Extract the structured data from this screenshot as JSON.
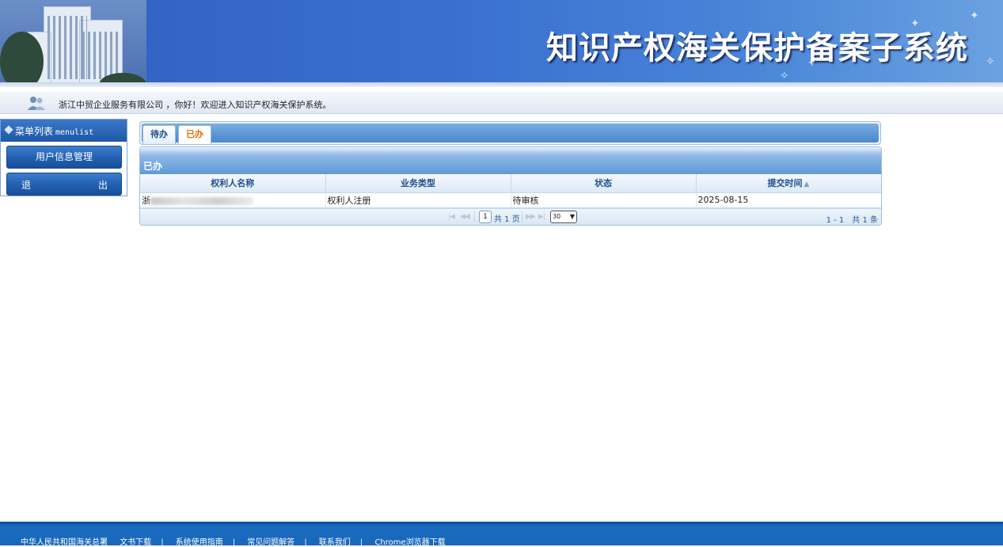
{
  "banner": {
    "title": "知识产权海关保护备案子系统"
  },
  "welcome": {
    "text": "浙江中贸企业服务有限公司 ，你好！欢迎进入知识产权海关保护系统。"
  },
  "sidebar": {
    "title": "菜单列表",
    "title_en": "menulist",
    "items": [
      {
        "label": "用户信息管理"
      },
      {
        "label_left": "退",
        "label_right": "出"
      }
    ]
  },
  "tabs": [
    {
      "label": "待办",
      "active": false
    },
    {
      "label": "已办",
      "active": true
    }
  ],
  "grid": {
    "caption": "已办",
    "columns": [
      "权利人名称",
      "业务类型",
      "状态",
      "提交时间"
    ],
    "rows": [
      {
        "name_prefix": "浙",
        "business_type": "权利人注册",
        "status": "待审核",
        "submit_time": "2025-08-15"
      }
    ]
  },
  "pager": {
    "current_page": "1",
    "total_pages_text": "共 1 页",
    "page_size": "30",
    "summary": "1 - 1　共 1 条"
  },
  "footer": {
    "links": [
      "中华人民共和国海关总署",
      "文书下载",
      "系统使用指南",
      "常见问题解答",
      "联系我们",
      "Chrome浏览器下载"
    ]
  }
}
